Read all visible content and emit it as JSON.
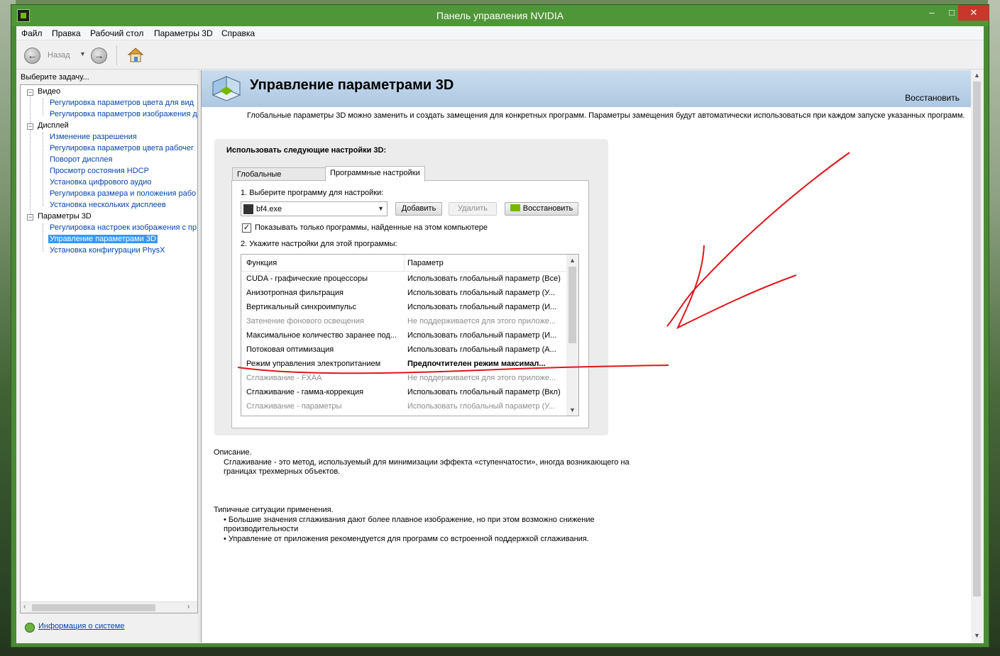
{
  "window": {
    "title": "Панель управления NVIDIA",
    "controls": {
      "minimize": "–",
      "maximize": "□",
      "close": "✕"
    }
  },
  "menu": [
    "Файл",
    "Правка",
    "Рабочий стол",
    "Параметры 3D",
    "Справка"
  ],
  "toolbar": {
    "back_label": "Назад",
    "back_icon": "arrow-left-icon",
    "forward_icon": "arrow-right-icon",
    "home_icon": "home-icon"
  },
  "sidebar": {
    "task_label": "Выберите задачу...",
    "categories": [
      {
        "label": "Видео",
        "items": [
          "Регулировка параметров цвета для вид",
          "Регулировка параметров изображения д"
        ]
      },
      {
        "label": "Дисплей",
        "items": [
          "Изменение разрешения",
          "Регулировка параметров цвета рабочег",
          "Поворот дисплея",
          "Просмотр состояния HDCP",
          "Установка цифрового аудио",
          "Регулировка размера и положения рабо",
          "Установка нескольких дисплеев"
        ]
      },
      {
        "label": "Параметры 3D",
        "items": [
          "Регулировка настроек изображения с пр",
          "Управление параметрами 3D",
          "Установка конфигурации PhysX"
        ]
      }
    ],
    "selected_item": "Управление параметрами 3D",
    "system_info": "Информация о системе"
  },
  "main": {
    "title": "Управление параметрами 3D",
    "restore": "Восстановить",
    "intro": "Глобальные параметры 3D можно заменить и создать замещения для конкретных программ. Параметры замещения будут автоматически использоваться при каждом запуске указанных программ.",
    "group_title": "Использовать следующие настройки 3D:",
    "tabs": [
      "Глобальные параметры",
      "Программные настройки"
    ],
    "active_tab": "Программные настройки",
    "step1": "1. Выберите программу для настройки:",
    "program": "bf4.exe",
    "add_button": "Добавить",
    "remove_button": "Удалить",
    "restore_button": "Восстановить",
    "show_only_checkbox": "Показывать только программы, найденные на этом компьютере",
    "show_only_checked": true,
    "step2": "2. Укажите настройки для этой программы:",
    "columns": [
      "Функция",
      "Параметр"
    ],
    "settings": [
      {
        "feature": "CUDA - графические процессоры",
        "value": "Использовать глобальный параметр (Все)",
        "state": "normal"
      },
      {
        "feature": "Анизотропная фильтрация",
        "value": "Использовать глобальный параметр (У...",
        "state": "normal"
      },
      {
        "feature": "Вертикальный синхроимпульс",
        "value": "Использовать глобальный параметр (И...",
        "state": "normal"
      },
      {
        "feature": "Затенение фонового освещения",
        "value": "Не поддерживается для этого приложе...",
        "state": "disabled"
      },
      {
        "feature": "Максимальное количество заранее под...",
        "value": "Использовать глобальный параметр (И...",
        "state": "normal"
      },
      {
        "feature": "Потоковая оптимизация",
        "value": "Использовать глобальный параметр (А...",
        "state": "normal"
      },
      {
        "feature": "Режим управления электропитанием",
        "value": "Предпочтителен режим максимал...",
        "state": "bold"
      },
      {
        "feature": "Сглаживание - FXAA",
        "value": "Не поддерживается для этого приложе...",
        "state": "disabled"
      },
      {
        "feature": "Сглаживание - гамма-коррекция",
        "value": "Использовать глобальный параметр (Вкл)",
        "state": "normal"
      },
      {
        "feature": "Сглаживание - параметры",
        "value": "Использовать глобальный параметр (У...",
        "state": "disabled"
      }
    ],
    "description_label": "Описание.",
    "description": "Сглаживание - это метод, используемый для минимизации эффекта «ступенчатости», иногда возникающего на границах трехмерных объектов.",
    "usage_label": "Типичные ситуации применения.",
    "usage": [
      "Большие значения сглаживания дают более плавное изображение, но при этом возможно снижение производительности",
      "Управление от приложения рекомендуется для программ со встроенной поддержкой сглаживания."
    ]
  },
  "annotation_color": "#e0151b"
}
